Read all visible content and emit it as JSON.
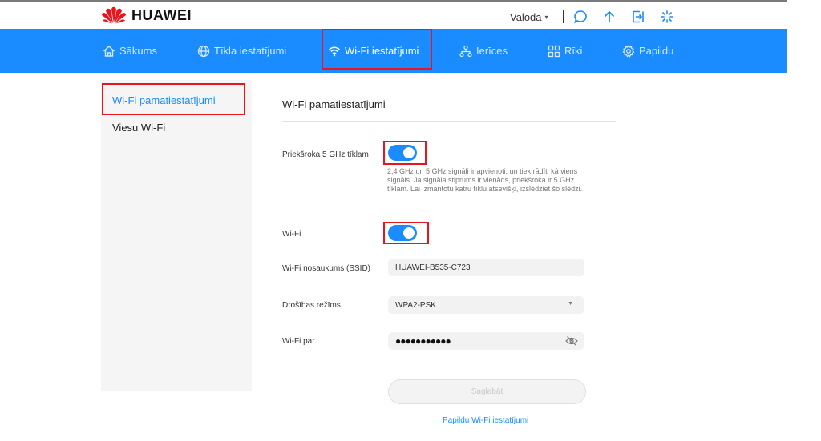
{
  "header": {
    "brand": "HUAWEI",
    "language_label": "Valoda",
    "language_caret": "▾"
  },
  "nav": {
    "items": [
      {
        "label": "Sākums",
        "icon": "home-icon"
      },
      {
        "label": "Tīkla iestatījumi",
        "icon": "globe-icon"
      },
      {
        "label": "Wi-Fi iestatījumi",
        "icon": "wifi-icon",
        "active": true
      },
      {
        "label": "Ierīces",
        "icon": "devices-icon"
      },
      {
        "label": "Rīki",
        "icon": "tools-icon"
      },
      {
        "label": "Papildu",
        "icon": "gear-icon"
      }
    ]
  },
  "sidebar": {
    "items": [
      {
        "label": "Wi-Fi pamatiestatījumi",
        "active": true
      },
      {
        "label": "Viesu Wi-Fi"
      }
    ]
  },
  "content": {
    "title": "Wi-Fi pamatiestatījumi",
    "prefer5g": {
      "label": "Priekšroka 5 GHz tīklam",
      "enabled": true,
      "description": "2,4 GHz un 5 GHz signāli ir apvienoti, un tiek rādīti kā viens signāls. Ja signāla stiprums ir vienāds, priekšroka ir 5 GHz tīklam. Lai izmantotu katru tīklu atsevišķi, izslēdziet šo slēdzi."
    },
    "wifi": {
      "label": "Wi-Fi",
      "enabled": true
    },
    "ssid": {
      "label": "Wi-Fi nosaukums (SSID)",
      "value": "HUAWEI-B535-C723"
    },
    "security": {
      "label": "Drošības režīms",
      "value": "WPA2-PSK"
    },
    "password": {
      "label": "Wi-Fi par.",
      "value": "●●●●●●●●●●●"
    },
    "save_label": "Saglabāt",
    "more_link": "Papildu Wi-Fi iestatījumi"
  },
  "colors": {
    "accent": "#1a8cff",
    "highlight": "#e8141e"
  }
}
